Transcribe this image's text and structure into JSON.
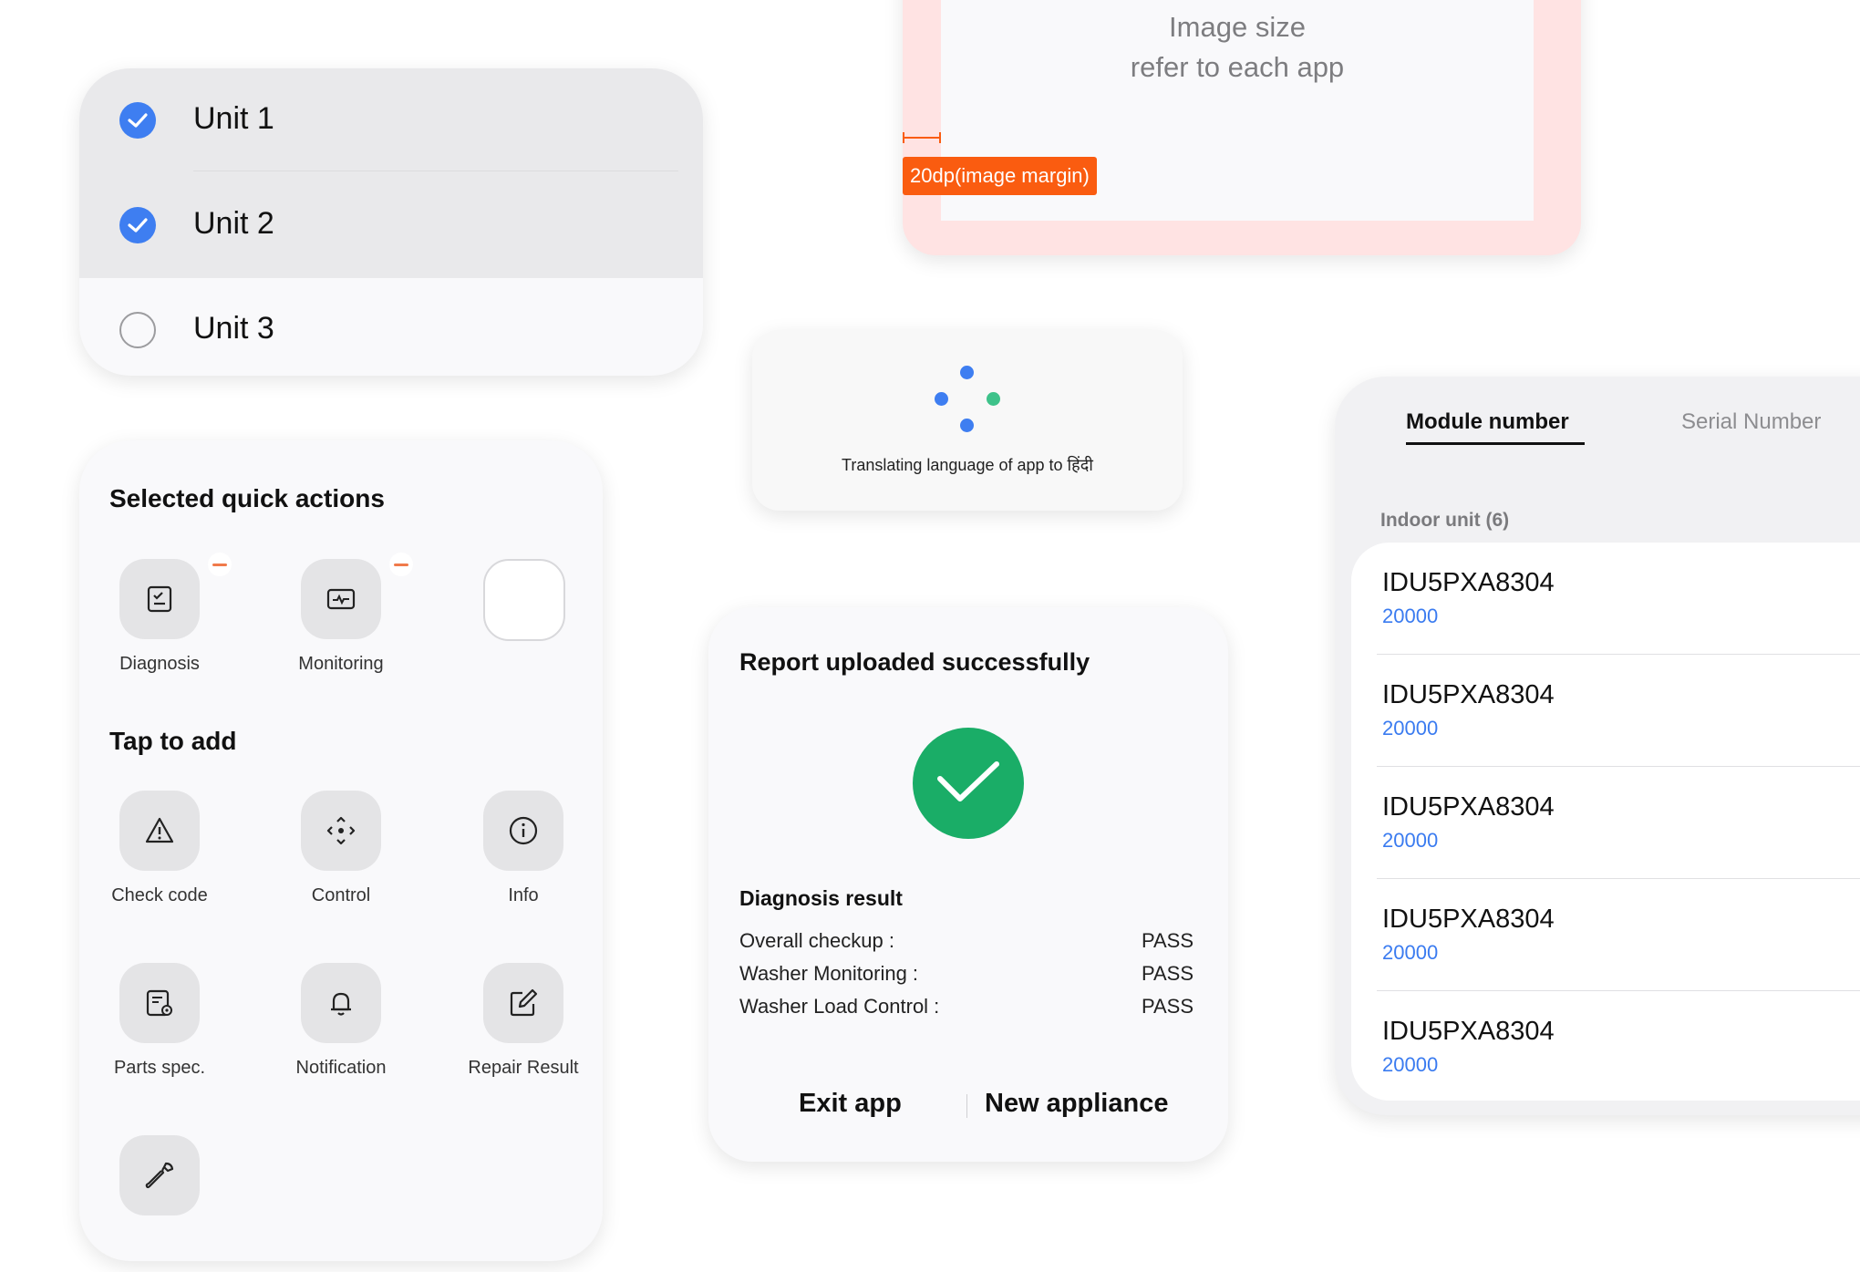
{
  "units": [
    {
      "label": "Unit 1",
      "checked": true
    },
    {
      "label": "Unit 2",
      "checked": true
    },
    {
      "label": "Unit 3",
      "checked": false
    }
  ],
  "quick_actions": {
    "selected_heading": "Selected quick actions",
    "selected": [
      {
        "label": "Diagnosis",
        "icon": "diagnosis-icon"
      },
      {
        "label": "Monitoring",
        "icon": "monitoring-icon"
      }
    ],
    "add_heading": "Tap to add",
    "available": [
      {
        "label": "Check code",
        "icon": "warning-icon"
      },
      {
        "label": "Control",
        "icon": "control-icon"
      },
      {
        "label": "Info",
        "icon": "info-icon"
      },
      {
        "label": "Parts spec.",
        "icon": "parts-spec-icon"
      },
      {
        "label": "Notification",
        "icon": "bell-icon"
      },
      {
        "label": "Repair Result",
        "icon": "edit-icon"
      },
      {
        "label": "",
        "icon": "wrench-icon"
      }
    ]
  },
  "image_spec": {
    "line1": "Image size",
    "line2": "refer to each app",
    "margin_tag": "20dp(image margin)"
  },
  "translating": {
    "text": "Translating language of app to  हिंदी"
  },
  "report": {
    "title": "Report uploaded successfully",
    "diagnosis_title": "Diagnosis result",
    "results": [
      {
        "label": "Overall checkup :",
        "value": "PASS"
      },
      {
        "label": "Washer Monitoring :",
        "value": "PASS"
      },
      {
        "label": "Washer Load Control :",
        "value": "PASS"
      }
    ],
    "exit_label": "Exit app",
    "new_label": "New appliance"
  },
  "modules": {
    "tab_module": "Module number",
    "tab_serial": "Serial Number",
    "section_label": "Indoor unit (6)",
    "items": [
      {
        "name": "IDU5PXA8304",
        "value": "20000"
      },
      {
        "name": "IDU5PXA8304",
        "value": "20000"
      },
      {
        "name": "IDU5PXA8304",
        "value": "20000"
      },
      {
        "name": "IDU5PXA8304",
        "value": "20000"
      },
      {
        "name": "IDU5PXA8304",
        "value": "20000"
      }
    ]
  },
  "colors": {
    "accent_blue": "#3e7ef1",
    "success_green": "#1aad67",
    "margin_orange": "#fa5c10",
    "loader_blue": "#3e7ef1",
    "loader_green": "#3ec28a"
  }
}
